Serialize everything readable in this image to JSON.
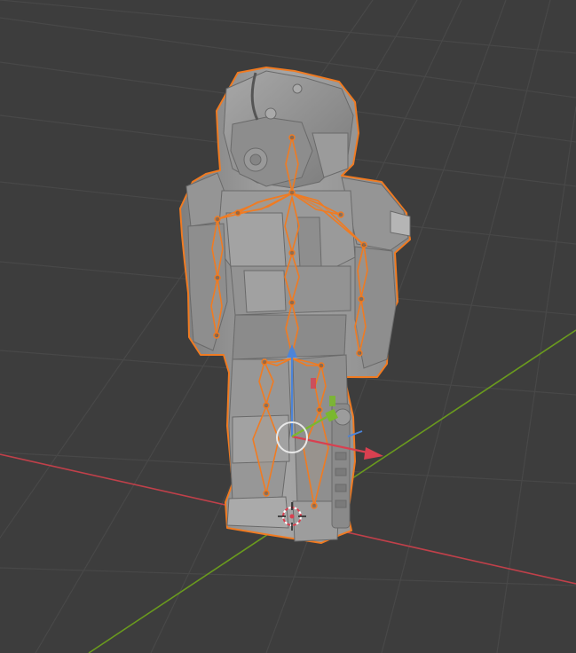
{
  "viewport": {
    "type": "3d-viewport",
    "background": "#3d3d3d",
    "grid_color": "#484848",
    "x_axis_color": "#c0404a",
    "y_axis_color": "#6a9a1e",
    "selection_outline": "#f07b22",
    "object_color": "#9a9a9a"
  },
  "scene": {
    "object": "character-mesh",
    "armature": "character-armature",
    "mode": "pose",
    "gizmo": "move-gizmo",
    "cursor": "3d-cursor"
  }
}
